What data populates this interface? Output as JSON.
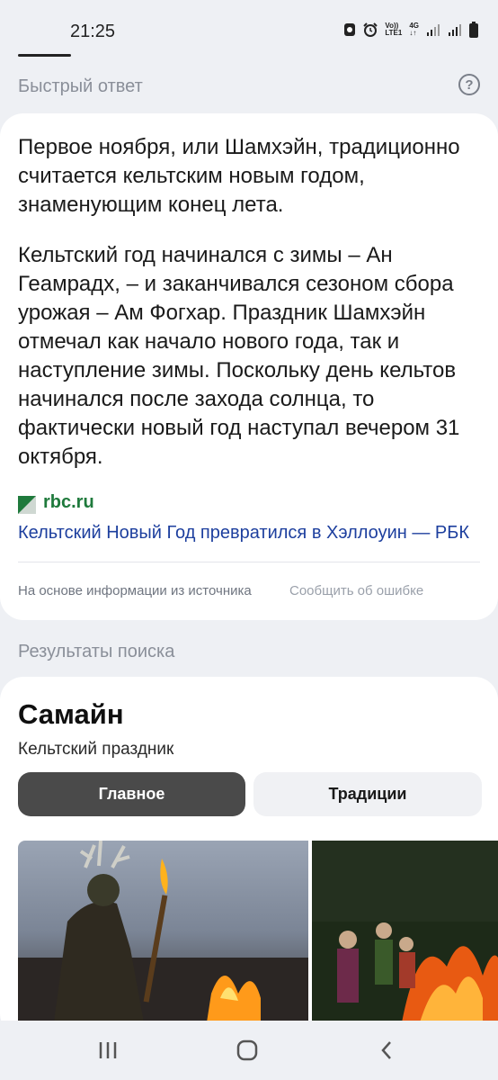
{
  "status_bar": {
    "time": "21:25",
    "icons": [
      "screen-saver-icon",
      "alarm-icon",
      "volte-icon",
      "4g-icon",
      "signal-icon",
      "signal-icon",
      "battery-icon"
    ],
    "volte_label": "Vo))\nLTE1",
    "net_label": "4G"
  },
  "quick_answer": {
    "section_label": "Быстрый ответ",
    "paragraphs": [
      "Первое ноября, или Шамхэйн, традиционно считается кельтским новым годом, знаменующим конец лета.",
      "Кельтский год начинался с зимы – Ан Геамрадх, – и заканчивался сезоном сбора урожая – Ам Фогхар. Праздник Шамхэйн отмечал как начало нового года, так и наступление зимы. Поскольку день кельтов начинался после захода солнца, то фактически новый год наступал вечером 31 октября."
    ],
    "source_domain": "rbc.ru",
    "source_link": "Кельтский Новый Год превратился в Хэллоуин — РБК",
    "footnote": "На основе информации из источника",
    "report_error": "Сообщить об ошибке"
  },
  "search_results": {
    "section_label": "Результаты поиска",
    "entity_title": "Самайн",
    "entity_subtitle": "Кельтский праздник",
    "tabs": [
      {
        "label": "Главное",
        "active": true
      },
      {
        "label": "Традиции",
        "active": false
      }
    ]
  },
  "colors": {
    "background": "#eef0f4",
    "link": "#1d3f9e",
    "source_green": "#1f7a3c",
    "active_pill": "#4a4a4a"
  }
}
